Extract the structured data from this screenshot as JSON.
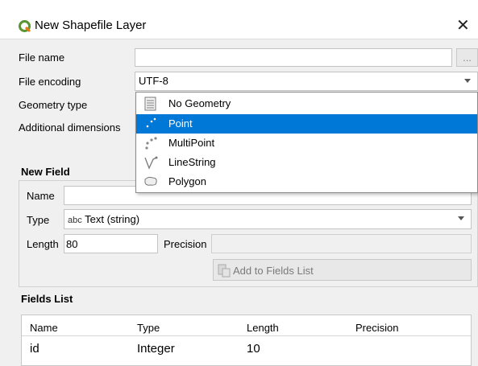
{
  "window": {
    "title": "New Shapefile Layer",
    "close_glyph": "✕",
    "logo_icon": "qgis-logo-icon",
    "accent": "#0078d7"
  },
  "form": {
    "file_name_label": "File name",
    "file_name_value": "",
    "browse_label": "...",
    "file_encoding_label": "File encoding",
    "file_encoding_value": "UTF-8",
    "geometry_type_label": "Geometry type",
    "additional_dimensions_label": "Additional dimensions"
  },
  "geometry_dropdown": {
    "selected": "Point",
    "options": [
      {
        "label": "No Geometry",
        "icon": "no-geometry-icon"
      },
      {
        "label": "Point",
        "icon": "point-icon"
      },
      {
        "label": "MultiPoint",
        "icon": "multipoint-icon"
      },
      {
        "label": "LineString",
        "icon": "linestring-icon"
      },
      {
        "label": "Polygon",
        "icon": "polygon-icon"
      }
    ]
  },
  "new_field": {
    "title": "New Field",
    "name_label": "Name",
    "name_value": "",
    "type_label": "Type",
    "type_icon_text": "abc",
    "type_value": "Text (string)",
    "length_label": "Length",
    "length_value": "80",
    "precision_label": "Precision",
    "precision_value": "",
    "add_button_label": "Add to Fields List"
  },
  "fields_list": {
    "title": "Fields List",
    "columns": [
      "Name",
      "Type",
      "Length",
      "Precision"
    ],
    "rows": [
      [
        "id",
        "Integer",
        "10",
        ""
      ]
    ]
  }
}
